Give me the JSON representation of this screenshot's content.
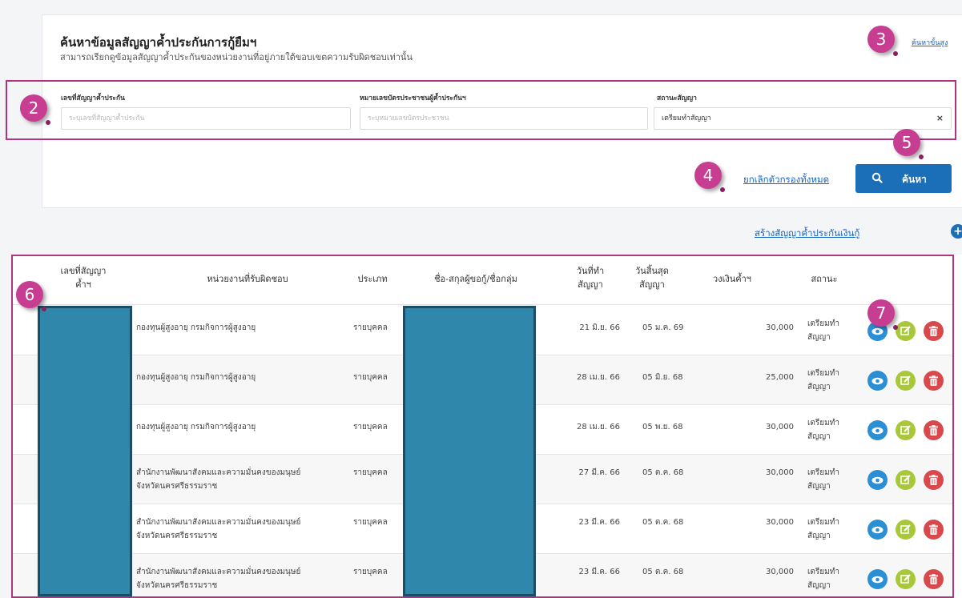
{
  "header": {
    "title": "ค้นหาข้อมูลสัญญาค้ำประกันการกู้ยืมฯ",
    "subtitle": "สามารถเรียกดูข้อมูลสัญญาค้ำประกันของหน่วยงานที่อยู่ภายใต้ขอบเขตความรับผิดชอบเท่านั้น",
    "advanced_link": "ค้นหาขั้นสูง"
  },
  "filters": {
    "contract_no": {
      "label": "เลขที่สัญญาค้ำประกัน",
      "placeholder": "ระบุเลขที่สัญญาค้ำประกัน",
      "value": ""
    },
    "id_card": {
      "label": "หมายเลขบัตรประชาชนผู้ค้ำประกันฯ",
      "placeholder": "ระบุหมายเลขบัตรประชาชน",
      "value": ""
    },
    "status": {
      "label": "สถานะสัญญา",
      "value": "เตรียมทำสัญญา",
      "clear": "×"
    }
  },
  "actions": {
    "clear_filters": "ยกเลิกตัวกรองทั้งหมด",
    "search": "ค้นหา",
    "create": "สร้างสัญญาค้ำประกันเงินกู้"
  },
  "table": {
    "headers": {
      "contract_no_1": "เลขที่สัญญา",
      "contract_no_2": "ค้ำฯ",
      "agency": "หน่วยงานที่รับผิดชอบ",
      "type": "ประเภท",
      "borrower": "ชื่อ-สกุลผู้ขอกู้/ชื่อกลุ่ม",
      "made_1": "วันที่ทำ",
      "made_2": "สัญญา",
      "end_1": "วันสิ้นสุด",
      "end_2": "สัญญา",
      "amount": "วงเงินค้ำฯ",
      "status": "สถานะ"
    },
    "rows": [
      {
        "agency_1": "กองทุนผู้สูงอายุ กรมกิจการผู้สูงอายุ",
        "agency_2": "",
        "type": "รายบุคคล",
        "made": "21 มิ.ย. 66",
        "end": "05 ม.ค. 69",
        "amount": "30,000",
        "status_1": "เตรียมทำ",
        "status_2": "สัญญา"
      },
      {
        "agency_1": "กองทุนผู้สูงอายุ กรมกิจการผู้สูงอายุ",
        "agency_2": "",
        "type": "รายบุคคล",
        "made": "28 เม.ย. 66",
        "end": "05 มิ.ย. 68",
        "amount": "25,000",
        "status_1": "เตรียมทำ",
        "status_2": "สัญญา"
      },
      {
        "agency_1": "กองทุนผู้สูงอายุ กรมกิจการผู้สูงอายุ",
        "agency_2": "",
        "type": "รายบุคคล",
        "made": "28 เม.ย. 66",
        "end": "05 พ.ย. 68",
        "amount": "30,000",
        "status_1": "เตรียมทำ",
        "status_2": "สัญญา"
      },
      {
        "agency_1": "สำนักงานพัฒนาสังคมและความมั่นคงของมนุษย์",
        "agency_2": "จังหวัดนครศรีธรรมราช",
        "type": "รายบุคคล",
        "made": "27 มี.ค. 66",
        "end": "05 ต.ค. 68",
        "amount": "30,000",
        "status_1": "เตรียมทำ",
        "status_2": "สัญญา"
      },
      {
        "agency_1": "สำนักงานพัฒนาสังคมและความมั่นคงของมนุษย์",
        "agency_2": "จังหวัดนครศรีธรรมราช",
        "type": "รายบุคคล",
        "made": "23 มี.ค. 66",
        "end": "05 ต.ค. 68",
        "amount": "30,000",
        "status_1": "เตรียมทำ",
        "status_2": "สัญญา"
      },
      {
        "agency_1": "สำนักงานพัฒนาสังคมและความมั่นคงของมนุษย์",
        "agency_2": "จังหวัดนครศรีธรรมราช",
        "type": "รายบุคคล",
        "made": "23 มี.ค. 66",
        "end": "05 ต.ค. 68",
        "amount": "30,000",
        "status_1": "เตรียมทำ",
        "status_2": "สัญญา"
      }
    ]
  },
  "badges": {
    "b2": "2",
    "b3": "3",
    "b4": "4",
    "b5": "5",
    "b6": "6",
    "b7": "7"
  },
  "colors": {
    "primary": "#1b6fb8",
    "annotation": "#c73d92",
    "view": "#2b8fd6",
    "edit": "#a8c83a",
    "delete": "#d9484a",
    "redaction": "#2f87ab"
  },
  "icons": {
    "search": "search-icon",
    "view": "eye-icon",
    "edit": "edit-icon",
    "delete": "trash-icon",
    "add": "plus-circle-icon",
    "clear": "close-icon"
  }
}
